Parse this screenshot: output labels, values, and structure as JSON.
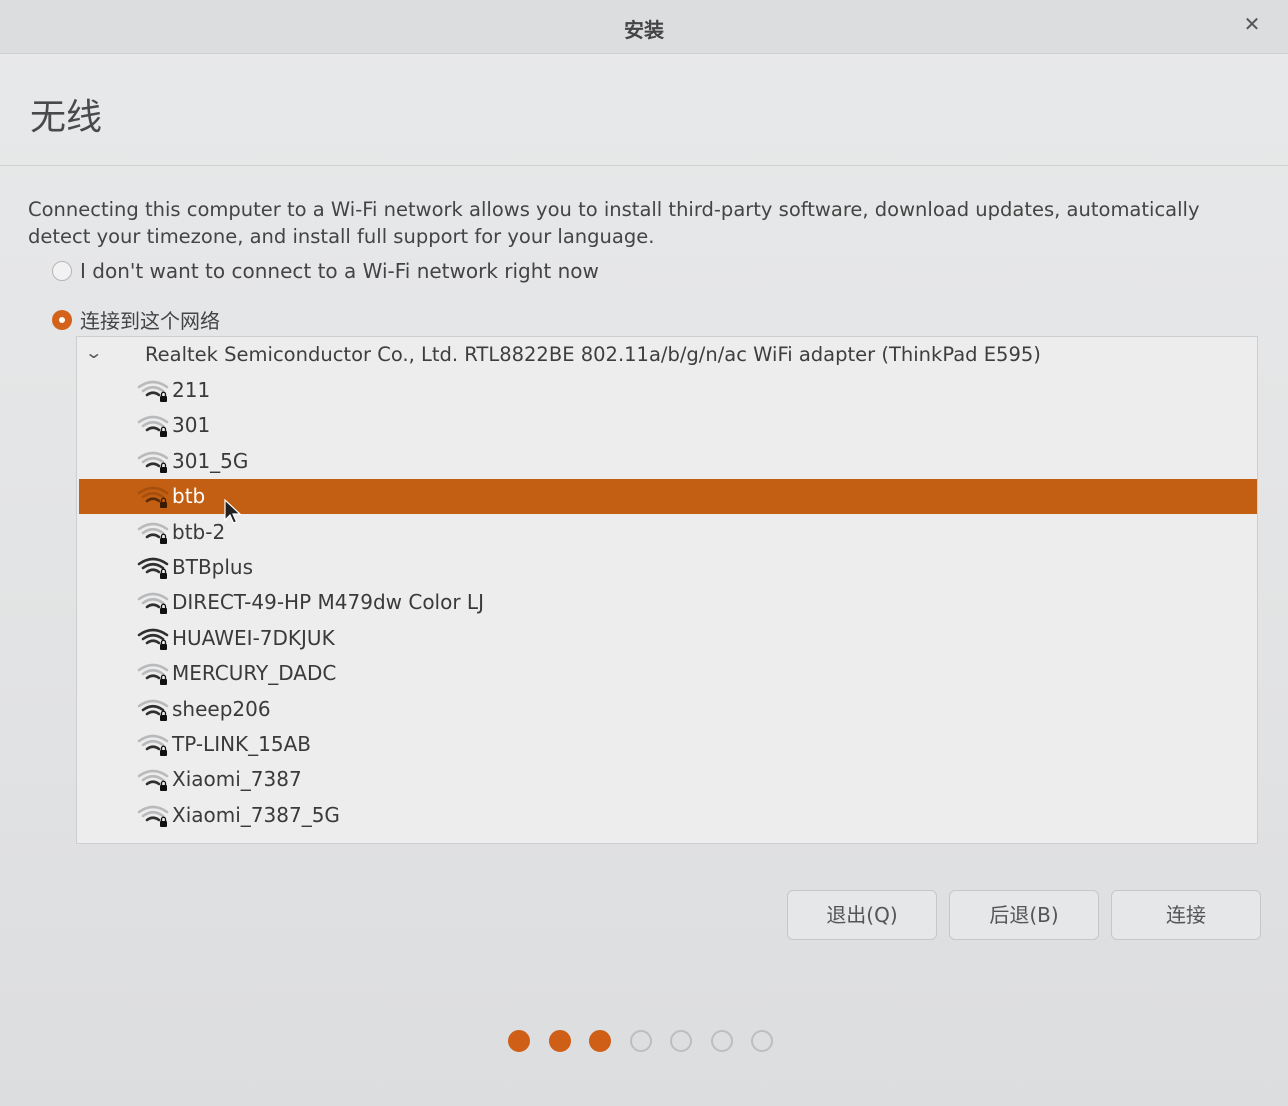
{
  "window": {
    "title": "安装"
  },
  "page": {
    "title": "无线",
    "description": "Connecting this computer to a Wi-Fi network allows you to install third-party software, download updates, automatically detect your timezone, and install full support for your language."
  },
  "options": {
    "no_wifi_label": "I don't want to connect to a Wi-Fi network right now",
    "connect_label": "连接到这个网络",
    "selected": "connect"
  },
  "adapter": {
    "label": "Realtek Semiconductor Co., Ltd. RTL8822BE 802.11a/b/g/n/ac WiFi adapter (ThinkPad E595)",
    "expanded": true
  },
  "networks": [
    {
      "ssid": "211",
      "signal": "weak",
      "secured": true
    },
    {
      "ssid": "301",
      "signal": "weak",
      "secured": true
    },
    {
      "ssid": "301_5G",
      "signal": "weak",
      "secured": true
    },
    {
      "ssid": "btb",
      "signal": "weak",
      "secured": true,
      "selected": true
    },
    {
      "ssid": "btb-2",
      "signal": "weak",
      "secured": true
    },
    {
      "ssid": "BTBplus",
      "signal": "strong",
      "secured": true
    },
    {
      "ssid": "DIRECT-49-HP M479dw Color LJ",
      "signal": "weak",
      "secured": true
    },
    {
      "ssid": "HUAWEI-7DKJUK",
      "signal": "strong",
      "secured": true
    },
    {
      "ssid": "MERCURY_DADC",
      "signal": "weak",
      "secured": true
    },
    {
      "ssid": "sheep206",
      "signal": "medium",
      "secured": true
    },
    {
      "ssid": "TP-LINK_15AB",
      "signal": "weak",
      "secured": true
    },
    {
      "ssid": "Xiaomi_7387",
      "signal": "weak",
      "secured": true
    },
    {
      "ssid": "Xiaomi_7387_5G",
      "signal": "weak",
      "secured": true
    }
  ],
  "buttons": {
    "quit": "退出(Q)",
    "back": "后退(B)",
    "connect": "连接"
  },
  "progress": {
    "current_step": 3,
    "total_steps": 7
  },
  "colors": {
    "accent": "#c25f12",
    "dot_accent": "#cf5f16"
  }
}
